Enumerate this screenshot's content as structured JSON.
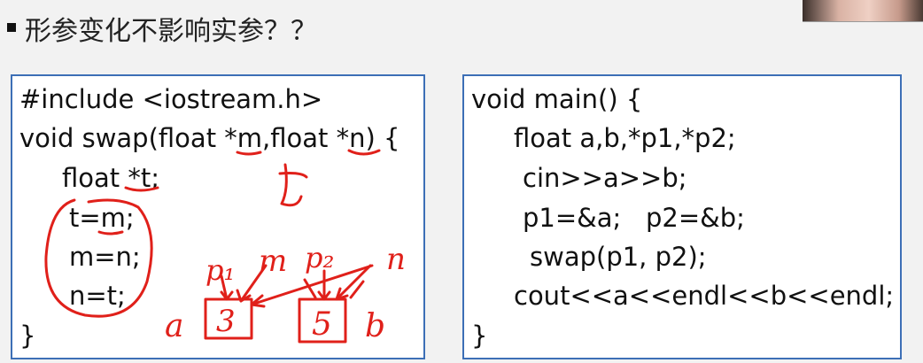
{
  "heading": "形参变化不影响实参？？",
  "left_code": [
    "#include <iostream.h>",
    "void swap(float *m,float *n) {",
    "float *t;",
    "t=m;",
    "m=n;",
    "n=t;",
    "}"
  ],
  "right_code": [
    "void main() {",
    "float a,b,*p1,*p2;",
    "cin>>a>>b;",
    "p1=&a;   p2=&b;",
    "swap(p1, p2);",
    "cout<<a<<endl<<b<<endl;",
    "}"
  ],
  "annotations": {
    "t": "t",
    "p1": "p₁",
    "m": "m",
    "p2": "p₂",
    "n": "n",
    "a": "a",
    "b": "b",
    "val_a": "3",
    "val_b": "5"
  },
  "colors": {
    "ink": "#e0201a",
    "box_border": "#3d6fb6"
  }
}
